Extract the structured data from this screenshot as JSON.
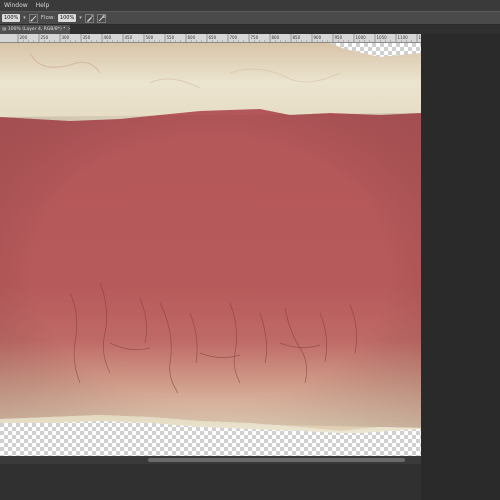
{
  "menubar": {
    "items": [
      {
        "label": "Window"
      },
      {
        "label": "Help"
      }
    ]
  },
  "options_bar": {
    "opacity_value": "100%",
    "flow_label": "Flow:",
    "flow_value": "100%"
  },
  "document_tab": {
    "title": "@ 100% (Layer 4, RGB/8*) *",
    "close": "×"
  },
  "ruler": {
    "labels": [
      "200",
      "250",
      "300",
      "350",
      "400",
      "450",
      "500",
      "550",
      "600",
      "650",
      "700",
      "750",
      "800",
      "850",
      "900",
      "950",
      "1000",
      "1050",
      "1100",
      "1150"
    ]
  },
  "colors": {
    "mask_red": "#b5585a",
    "skin_light": "#ece4cf",
    "skin_mid": "#d9c7a8",
    "transparency_check": "#d0d0d0",
    "panel_dark": "#2a2a2a"
  },
  "scrollbar": {
    "thumb_fraction": 0.61
  }
}
